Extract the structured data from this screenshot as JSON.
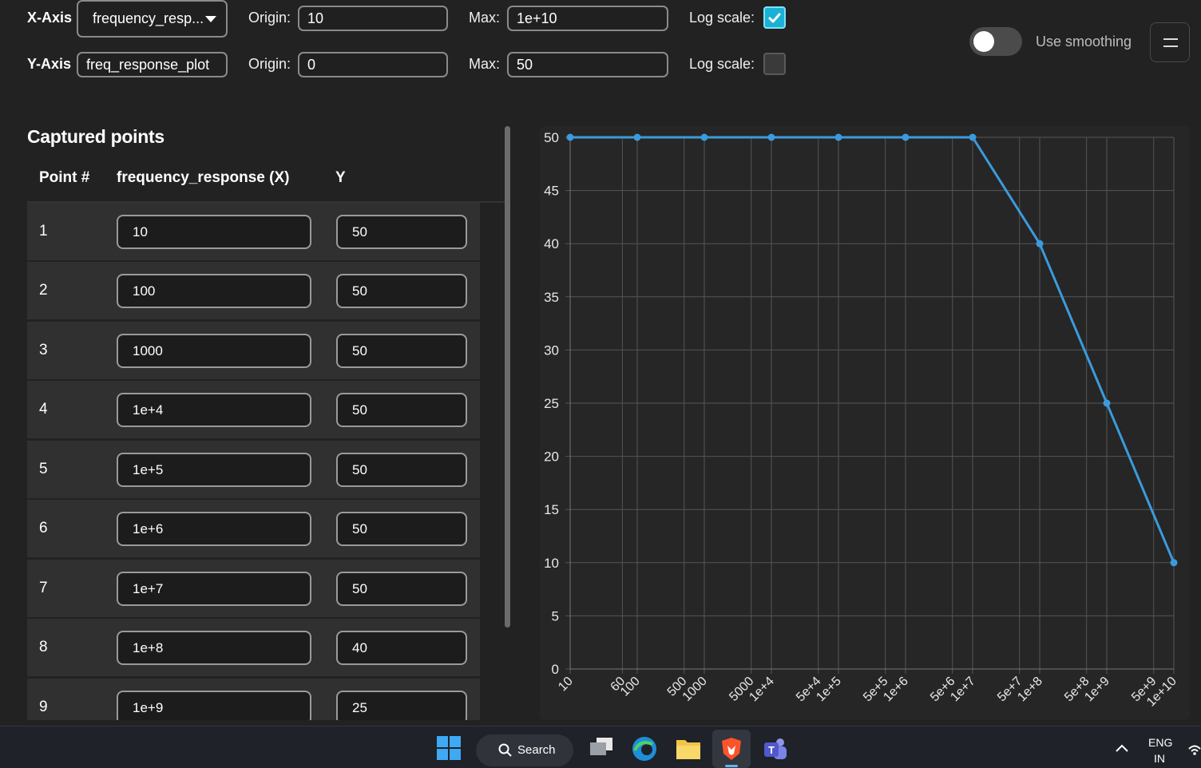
{
  "controls": {
    "x_axis": {
      "label": "X-Axis",
      "value": "frequency_resp...",
      "origin_label": "Origin:",
      "origin": "10",
      "max_label": "Max:",
      "max": "1e+10",
      "log_label": "Log scale:",
      "log_checked": true
    },
    "y_axis": {
      "label": "Y-Axis",
      "value": "freq_response_plot",
      "origin_label": "Origin:",
      "origin": "0",
      "max_label": "Max:",
      "max": "50",
      "log_label": "Log scale:",
      "log_checked": false
    },
    "smoothing_label": "Use smoothing"
  },
  "points": {
    "title": "Captured points",
    "headers": {
      "num": "Point #",
      "x": "frequency_response (X)",
      "y": "Y"
    },
    "rows": [
      {
        "n": "1",
        "x": "10",
        "y": "50"
      },
      {
        "n": "2",
        "x": "100",
        "y": "50"
      },
      {
        "n": "3",
        "x": "1000",
        "y": "50"
      },
      {
        "n": "4",
        "x": "1e+4",
        "y": "50"
      },
      {
        "n": "5",
        "x": "1e+5",
        "y": "50"
      },
      {
        "n": "6",
        "x": "1e+6",
        "y": "50"
      },
      {
        "n": "7",
        "x": "1e+7",
        "y": "50"
      },
      {
        "n": "8",
        "x": "1e+8",
        "y": "40"
      },
      {
        "n": "9",
        "x": "1e+9",
        "y": "25"
      }
    ]
  },
  "chart_data": {
    "type": "line",
    "x_scale": "log",
    "xlim": [
      10,
      10000000000
    ],
    "ylim": [
      0,
      50
    ],
    "grid": true,
    "color": "#3b9bdc",
    "y_ticks": [
      0,
      5,
      10,
      15,
      20,
      25,
      30,
      35,
      40,
      45,
      50
    ],
    "x_ticks": [
      {
        "v": 10,
        "t": "10"
      },
      {
        "v": 60,
        "t": "60"
      },
      {
        "v": 100,
        "t": "100"
      },
      {
        "v": 500,
        "t": "500"
      },
      {
        "v": 1000,
        "t": "1000"
      },
      {
        "v": 5000,
        "t": "5000"
      },
      {
        "v": 10000,
        "t": "1e+4"
      },
      {
        "v": 50000,
        "t": "5e+4"
      },
      {
        "v": 100000,
        "t": "1e+5"
      },
      {
        "v": 500000,
        "t": "5e+5"
      },
      {
        "v": 1000000,
        "t": "1e+6"
      },
      {
        "v": 5000000,
        "t": "5e+6"
      },
      {
        "v": 10000000,
        "t": "1e+7"
      },
      {
        "v": 50000000,
        "t": "5e+7"
      },
      {
        "v": 100000000,
        "t": "1e+8"
      },
      {
        "v": 500000000,
        "t": "5e+8"
      },
      {
        "v": 1000000000,
        "t": "1e+9"
      },
      {
        "v": 5000000000,
        "t": "5e+9"
      },
      {
        "v": 10000000000,
        "t": "1e+10"
      }
    ],
    "x": [
      10,
      100,
      1000,
      10000,
      100000,
      1000000,
      10000000,
      100000000,
      1000000000,
      10000000000
    ],
    "y": [
      50,
      50,
      50,
      50,
      50,
      50,
      50,
      40,
      25,
      10
    ]
  },
  "taskbar": {
    "search_label": "Search",
    "lang": "ENG",
    "region": "IN"
  }
}
